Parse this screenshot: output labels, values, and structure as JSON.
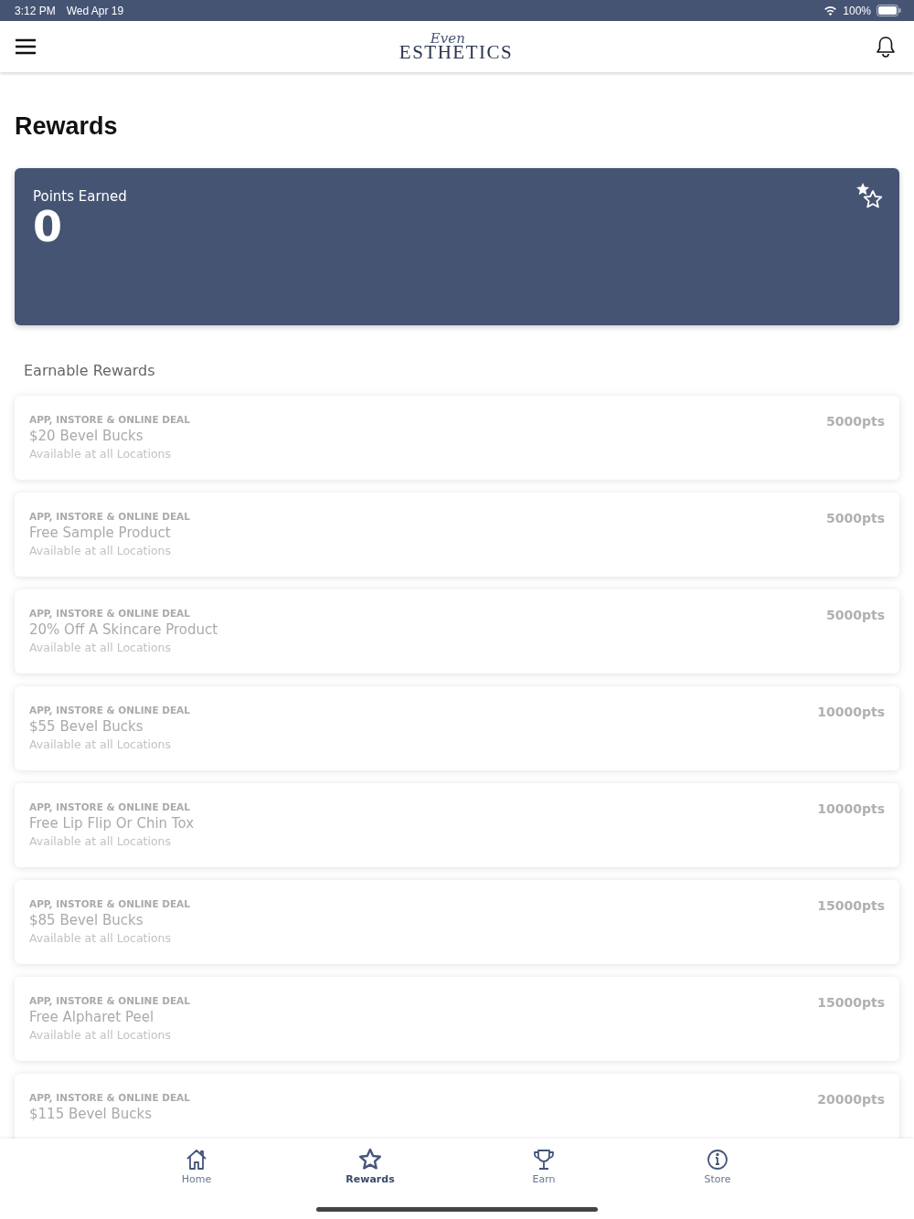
{
  "status_bar": {
    "time": "3:12 PM",
    "date": "Wed Apr 19",
    "battery": "100%"
  },
  "header": {
    "logo_script": "Even",
    "logo": "ESTHETICS"
  },
  "title": "Rewards",
  "points": {
    "label": "Points Earned",
    "value": "0"
  },
  "section_title": "Earnable Rewards",
  "rewards": [
    {
      "tag": "APP, INSTORE & ONLINE DEAL",
      "name": "$20 Bevel Bucks",
      "note": "Available at all Locations",
      "points": "5000pts"
    },
    {
      "tag": "APP, INSTORE & ONLINE DEAL",
      "name": "Free Sample Product",
      "note": "Available at all Locations",
      "points": "5000pts"
    },
    {
      "tag": "APP, INSTORE & ONLINE DEAL",
      "name": "20% Off A Skincare Product",
      "note": "Available at all Locations",
      "points": "5000pts"
    },
    {
      "tag": "APP, INSTORE & ONLINE DEAL",
      "name": "$55 Bevel Bucks",
      "note": "Available at all Locations",
      "points": "10000pts"
    },
    {
      "tag": "APP, INSTORE & ONLINE DEAL",
      "name": "Free Lip Flip Or Chin Tox",
      "note": "Available at all Locations",
      "points": "10000pts"
    },
    {
      "tag": "APP, INSTORE & ONLINE DEAL",
      "name": "$85 Bevel Bucks",
      "note": "Available at all Locations",
      "points": "15000pts"
    },
    {
      "tag": "APP, INSTORE & ONLINE DEAL",
      "name": "Free Alpharet Peel",
      "note": "Available at all Locations",
      "points": "15000pts"
    },
    {
      "tag": "APP, INSTORE & ONLINE DEAL",
      "name": "$115 Bevel Bucks",
      "points": "20000pts"
    }
  ],
  "tabs": [
    {
      "kind": "home",
      "label": "Home",
      "selected": false
    },
    {
      "kind": "rewards",
      "label": "Rewards",
      "selected": true
    },
    {
      "kind": "earn",
      "label": "Earn",
      "selected": false
    },
    {
      "kind": "store",
      "label": "Store",
      "selected": false
    }
  ]
}
